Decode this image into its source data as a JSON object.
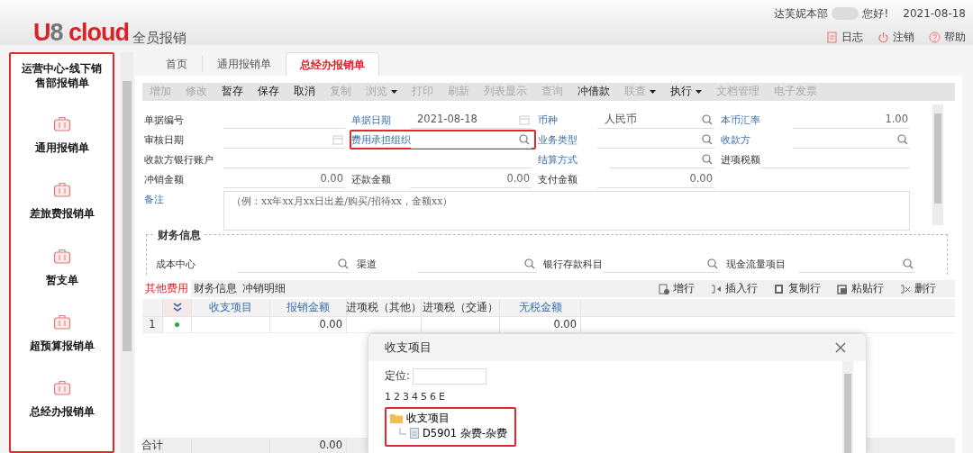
{
  "header": {
    "logo": {
      "brand": "U8 cloud",
      "product": "全员报销"
    },
    "user": {
      "org": "达芙妮本部",
      "greeting": "您好!",
      "date": "2021-08-18"
    },
    "links": [
      {
        "kind": "log",
        "label": "日志"
      },
      {
        "kind": "logout",
        "label": "注销"
      },
      {
        "kind": "help",
        "label": "帮助"
      }
    ]
  },
  "sidebar": {
    "highlighted": true,
    "title": "运营中心-线下销售部报销单",
    "items": [
      {
        "label": "通用报销单"
      },
      {
        "label": "差旅费报销单"
      },
      {
        "label": "暂支单"
      },
      {
        "label": "超预算报销单"
      },
      {
        "label": "总经办报销单"
      }
    ]
  },
  "tabs": [
    {
      "label": "首页",
      "selected": false
    },
    {
      "label": "通用报销单",
      "selected": false
    },
    {
      "label": "总经办报销单",
      "selected": true
    }
  ],
  "toolbar": [
    {
      "label": "增加",
      "disabled": true,
      "dropdown": false
    },
    {
      "label": "修改",
      "disabled": true,
      "dropdown": false
    },
    {
      "label": "暂存",
      "disabled": false,
      "dropdown": false
    },
    {
      "label": "保存",
      "disabled": false,
      "dropdown": false
    },
    {
      "label": "取消",
      "disabled": false,
      "dropdown": false
    },
    {
      "label": "复制",
      "disabled": true,
      "dropdown": false
    },
    {
      "label": "浏览",
      "disabled": true,
      "dropdown": true
    },
    {
      "label": "打印",
      "disabled": true,
      "dropdown": false
    },
    {
      "label": "刷新",
      "disabled": true,
      "dropdown": false
    },
    {
      "label": "列表显示",
      "disabled": true,
      "dropdown": false
    },
    {
      "label": "查询",
      "disabled": true,
      "dropdown": false
    },
    {
      "label": "冲借款",
      "disabled": false,
      "dropdown": false
    },
    {
      "label": "联查",
      "disabled": true,
      "dropdown": true
    },
    {
      "label": "执行",
      "disabled": false,
      "dropdown": true
    },
    {
      "label": "文档管理",
      "disabled": true,
      "dropdown": false
    },
    {
      "label": "电子发票",
      "disabled": true,
      "dropdown": false
    }
  ],
  "form": {
    "rows": [
      [
        {
          "label": "单据编号",
          "linked": false,
          "kind": "text",
          "highlighted": false
        },
        {
          "label": "单据日期",
          "linked": true,
          "kind": "date",
          "value": "2021-08-18",
          "highlighted": false
        },
        {
          "label": "币种",
          "linked": true,
          "kind": "search",
          "value": "人民币",
          "highlighted": false
        },
        {
          "label": "本币汇率",
          "linked": true,
          "kind": "number",
          "value": "1.00",
          "highlighted": false
        }
      ],
      [
        {
          "label": "审核日期",
          "linked": false,
          "kind": "date",
          "highlighted": false
        },
        {
          "label": "费用承担组织",
          "linked": true,
          "kind": "search",
          "highlighted": true
        },
        {
          "label": "业务类型",
          "linked": true,
          "kind": "search",
          "highlighted": false
        },
        {
          "label": "收款方",
          "linked": true,
          "kind": "search",
          "highlighted": false
        }
      ],
      [
        {
          "label": "收款方银行账户",
          "linked": false,
          "kind": "text",
          "highlighted": false
        },
        "",
        {
          "label": "结算方式",
          "linked": true,
          "kind": "search",
          "highlighted": false
        },
        {
          "label": "进项税额",
          "linked": false,
          "kind": "text",
          "highlighted": false
        }
      ],
      [
        {
          "label": "冲销金额",
          "linked": false,
          "kind": "number",
          "value": "0.00",
          "highlighted": false
        },
        {
          "label": "还款金额",
          "linked": false,
          "kind": "number",
          "value": "0.00",
          "highlighted": false
        },
        {
          "label": "支付金额",
          "linked": false,
          "kind": "number",
          "value": "0.00",
          "highlighted": false
        }
      ],
      [
        {
          "label": "备注",
          "linked": true,
          "kind": "memo",
          "placeholder": "（例：xx年xx月xx日出差/购买/招待xx，金额xx）",
          "highlighted": false
        }
      ]
    ]
  },
  "finance": {
    "title": "财务信息",
    "fields": [
      {
        "label": "成本中心"
      },
      {
        "label": "渠道"
      },
      {
        "label": "银行存款科目"
      },
      {
        "label": "现金流量项目"
      }
    ]
  },
  "detail_tabs": [
    {
      "label": "其他费用",
      "selected": true
    },
    {
      "label": "财务信息",
      "selected": false
    },
    {
      "label": "冲销明细",
      "selected": false
    }
  ],
  "row_actions": [
    {
      "kind": "add",
      "label": "增行"
    },
    {
      "kind": "insert",
      "label": "插入行"
    },
    {
      "kind": "copy",
      "label": "复制行"
    },
    {
      "kind": "paste",
      "label": "粘贴行"
    },
    {
      "kind": "delete",
      "label": "删行"
    }
  ],
  "grid": {
    "columns": [
      {
        "label": "收支项目",
        "linked": true
      },
      {
        "label": "报销金额",
        "linked": true
      },
      {
        "label": "进项税（其他）",
        "linked": false
      },
      {
        "label": "进项税（交通）",
        "linked": false
      },
      {
        "label": "无税金额",
        "linked": true
      }
    ],
    "rows": [
      {
        "number": "1",
        "edited": true,
        "cells": [
          "",
          "0.00",
          "",
          "",
          "0.00"
        ]
      }
    ],
    "footer": {
      "label": "合计",
      "amount_total": "0.00"
    }
  },
  "dialog": {
    "title": "收支项目",
    "locate_label": "定位:",
    "levels": [
      "1",
      "2",
      "3",
      "4",
      "5",
      "6",
      "E"
    ],
    "tree": {
      "highlighted": true,
      "nodes": [
        {
          "label": "收支项目",
          "children": [
            {
              "label": "D5901 杂费-杂费"
            }
          ]
        }
      ]
    }
  }
}
